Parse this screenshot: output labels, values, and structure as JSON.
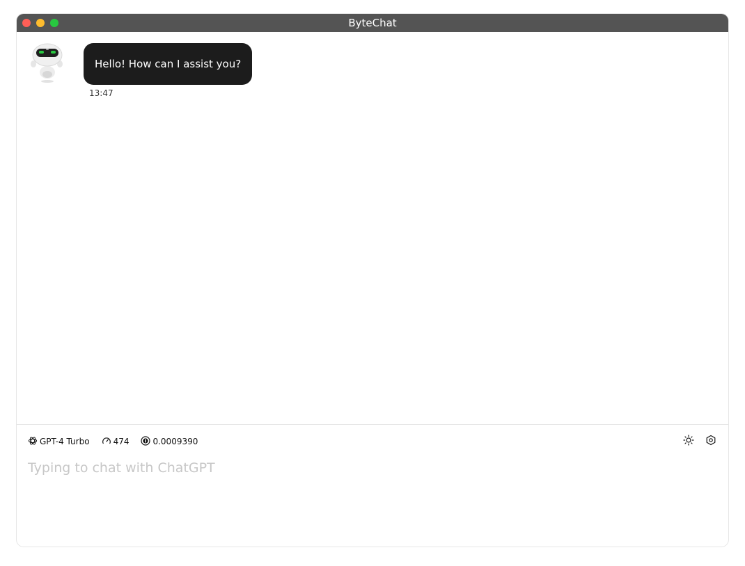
{
  "window": {
    "title": "ByteChat"
  },
  "messages": [
    {
      "role": "assistant",
      "text": "Hello! How can I assist you?",
      "time": "13:47"
    }
  ],
  "status": {
    "model": "GPT-4 Turbo",
    "tokens": "474",
    "cost": "0.0009390"
  },
  "input": {
    "placeholder": "Typing to chat with ChatGPT",
    "value": ""
  },
  "icons": {
    "model": "openai-icon",
    "tokens": "gauge-icon",
    "cost": "coin-icon",
    "theme": "sun-icon",
    "settings": "settings-hexagon-icon"
  },
  "colors": {
    "titlebar": "#545454",
    "bubble": "#1c1c1c",
    "close": "#ff5f57",
    "minimize": "#febc2e",
    "maximize": "#28c840",
    "placeholder": "#c7c7c7"
  }
}
